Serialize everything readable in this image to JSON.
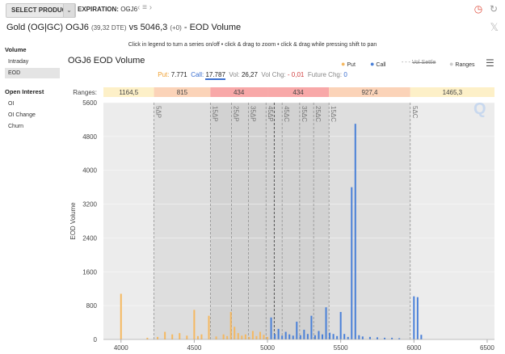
{
  "toolbar": {
    "select_product_label": "SELECT PRODUCT",
    "expiration_label": "EXPIRATION:",
    "expiration_value": "OGJ6"
  },
  "header": {
    "title_main": "Gold (OG|GC) OGJ6",
    "title_dte": "(39,32 DTE)",
    "title_rest": "vs 5046,3",
    "title_change": "(+0)",
    "title_suffix": "- EOD Volume"
  },
  "hint": "Click in legend to turn a series on/off • click & drag to zoom • click & drag while pressing shift to pan",
  "sidebar": {
    "volume_heading": "Volume",
    "volume_items": [
      {
        "label": "Intraday",
        "active": false
      },
      {
        "label": "EOD",
        "active": true
      }
    ],
    "oi_heading": "Open Interest",
    "oi_items": [
      {
        "label": "OI",
        "active": false
      },
      {
        "label": "OI Change",
        "active": false
      },
      {
        "label": "Churn",
        "active": false
      }
    ]
  },
  "chart_title": "OGJ6 EOD Volume",
  "legend": {
    "put": "Put",
    "call": "Call",
    "vol_settle": "Vol Settle",
    "ranges": "Ranges"
  },
  "stats": {
    "put_label": "Put:",
    "put_value": "7.771",
    "call_label": "Call:",
    "call_value": "17.787",
    "vol_label": "Vol:",
    "vol_value": "26,27",
    "vol_chg_label": "Vol Chg:",
    "vol_chg_value": "- 0,01",
    "future_chg_label": "Future Chg:",
    "future_chg_value": "0"
  },
  "colors": {
    "put": "#f5b860",
    "call": "#4a80d8",
    "range_light": "#fdf0c8",
    "range_mid": "#fbc8a8",
    "range_red": "#f8a8a8"
  },
  "chart_data": {
    "type": "bar",
    "ylabel": "EOD Volume",
    "ranges_label": "Ranges:",
    "xlim": [
      3880,
      6550
    ],
    "ylim": [
      0,
      5600
    ],
    "xticks": [
      4000,
      4500,
      5000,
      5500,
      6000,
      6500
    ],
    "yticks": [
      0,
      800,
      1600,
      2400,
      3200,
      4000,
      4800,
      5600
    ],
    "underlying": 5046.3,
    "range_bands": [
      {
        "from": 3880,
        "to": 4225,
        "label": "1164,5",
        "color": "#fdf0c8"
      },
      {
        "from": 4225,
        "to": 4610,
        "label": "815",
        "color": "#fbd3b8"
      },
      {
        "from": 4610,
        "to": 5000,
        "label": "434",
        "color": "#f8a8a8"
      },
      {
        "from": 5000,
        "to": 5420,
        "label": "434",
        "color": "#f8a8a8"
      },
      {
        "from": 5420,
        "to": 5975,
        "label": "927,4",
        "color": "#fbd3b8"
      },
      {
        "from": 5975,
        "to": 6550,
        "label": "1465,3",
        "color": "#fdf0c8"
      }
    ],
    "shade_bands": [
      {
        "from": 3880,
        "to": 4225,
        "level": 1
      },
      {
        "from": 4225,
        "to": 4610,
        "level": 2
      },
      {
        "from": 4610,
        "to": 5000,
        "level": 3
      },
      {
        "from": 5000,
        "to": 5420,
        "level": 3
      },
      {
        "from": 5420,
        "to": 5975,
        "level": 2
      },
      {
        "from": 5975,
        "to": 6550,
        "level": 1
      }
    ],
    "vlines": [
      {
        "x": 4225,
        "label": "5ΔP"
      },
      {
        "x": 4610,
        "label": "15ΔP"
      },
      {
        "x": 4755,
        "label": "25ΔP"
      },
      {
        "x": 4870,
        "label": "35ΔP"
      },
      {
        "x": 4990,
        "label": "45ΔP"
      },
      {
        "x": 5046.3,
        "label": "",
        "dark": true
      },
      {
        "x": 5100,
        "label": "45ΔC"
      },
      {
        "x": 5220,
        "label": "35ΔC"
      },
      {
        "x": 5315,
        "label": "25ΔC"
      },
      {
        "x": 5420,
        "label": "15ΔC"
      },
      {
        "x": 5975,
        "label": "5ΔC"
      }
    ],
    "series": [
      {
        "name": "Put",
        "color": "#f5b860",
        "points": [
          [
            4000,
            1080
          ],
          [
            4180,
            40
          ],
          [
            4250,
            60
          ],
          [
            4300,
            180
          ],
          [
            4350,
            120
          ],
          [
            4400,
            150
          ],
          [
            4450,
            90
          ],
          [
            4500,
            700
          ],
          [
            4525,
            80
          ],
          [
            4550,
            120
          ],
          [
            4600,
            560
          ],
          [
            4650,
            70
          ],
          [
            4700,
            120
          ],
          [
            4725,
            80
          ],
          [
            4750,
            650
          ],
          [
            4775,
            300
          ],
          [
            4800,
            150
          ],
          [
            4825,
            90
          ],
          [
            4850,
            120
          ],
          [
            4875,
            60
          ],
          [
            4900,
            200
          ],
          [
            4925,
            80
          ],
          [
            4950,
            180
          ],
          [
            4975,
            110
          ],
          [
            5000,
            60
          ],
          [
            5025,
            40
          ],
          [
            5050,
            30
          ]
        ]
      },
      {
        "name": "Call",
        "color": "#4a80d8",
        "points": [
          [
            5025,
            520
          ],
          [
            5050,
            130
          ],
          [
            5075,
            250
          ],
          [
            5100,
            90
          ],
          [
            5125,
            180
          ],
          [
            5150,
            120
          ],
          [
            5175,
            90
          ],
          [
            5200,
            420
          ],
          [
            5225,
            100
          ],
          [
            5250,
            230
          ],
          [
            5275,
            130
          ],
          [
            5300,
            560
          ],
          [
            5325,
            100
          ],
          [
            5350,
            200
          ],
          [
            5375,
            120
          ],
          [
            5400,
            760
          ],
          [
            5425,
            160
          ],
          [
            5450,
            130
          ],
          [
            5475,
            80
          ],
          [
            5500,
            650
          ],
          [
            5525,
            130
          ],
          [
            5550,
            60
          ],
          [
            5575,
            3600
          ],
          [
            5600,
            5100
          ],
          [
            5625,
            100
          ],
          [
            5650,
            70
          ],
          [
            5700,
            60
          ],
          [
            5750,
            50
          ],
          [
            5800,
            40
          ],
          [
            5850,
            40
          ],
          [
            5900,
            30
          ],
          [
            6000,
            1020
          ],
          [
            6025,
            1000
          ],
          [
            6050,
            110
          ]
        ]
      }
    ]
  }
}
